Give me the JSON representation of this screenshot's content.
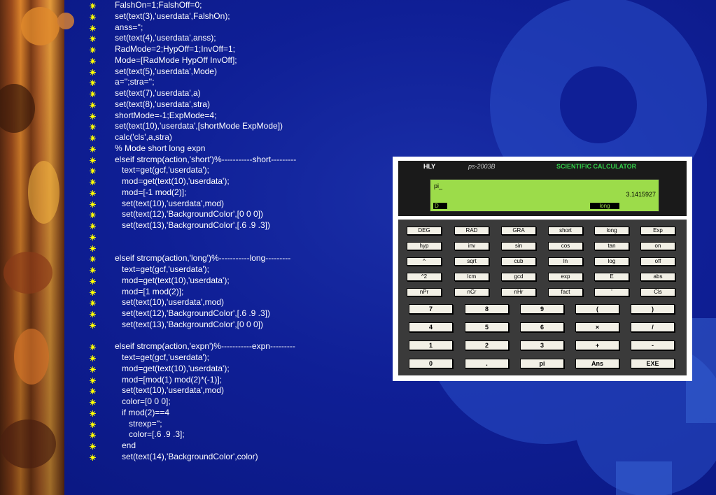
{
  "code_lines": [
    "FalshOn=1;FalshOff=0;",
    "set(text(3),'userdata',FalshOn);",
    "anss='';",
    "set(text(4),'userdata',anss);",
    "RadMode=2;HypOff=1;InvOff=1;",
    "Mode=[RadMode HypOff InvOff];",
    "set(text(5),'userdata',Mode)",
    "a='';stra='';",
    "set(text(7),'userdata',a)",
    "set(text(8),'userdata',stra)",
    "shortMode=-1;ExpMode=4;",
    "set(text(10),'userdata',[shortMode ExpMode])",
    "calc('cls',a,stra)",
    "% Mode short long expn",
    "elseif strcmp(action,'short')%-----------short---------",
    "   text=get(gcf,'userdata');",
    "   mod=get(text(10),'userdata');",
    "   mod=[-1 mod(2)];",
    "   set(text(10),'userdata',mod)",
    "   set(text(12),'BackgroundColor',[0 0 0])",
    "   set(text(13),'BackgroundColor',[.6 .9 .3])",
    "",
    "",
    "elseif strcmp(action,'long')%-----------long---------",
    "   text=get(gcf,'userdata');",
    "   mod=get(text(10),'userdata');",
    "   mod=[1 mod(2)];",
    "   set(text(10),'userdata',mod)",
    "   set(text(12),'BackgroundColor',[.6 .9 .3])",
    "   set(text(13),'BackgroundColor',[0 0 0])",
    null,
    "elseif strcmp(action,'expn')%-----------expn---------",
    "   text=get(gcf,'userdata');",
    "   mod=get(text(10),'userdata');",
    "   mod=[mod(1) mod(2)*(-1)];",
    "   set(text(10),'userdata',mod)",
    "   color=[0 0 0];",
    "   if mod(2)==4",
    "      strexp='';",
    "      color=[.6 .9 .3];",
    "   end",
    "   set(text(14),'BackgroundColor',color)"
  ],
  "calculator": {
    "brand": "HLY",
    "version": "ps-2003B",
    "title": "SCIENTIFIC CALCULATOR",
    "display_input": "pi_",
    "display_result": "3.1415927",
    "mode_indicator": "D",
    "format_indicator": "long",
    "function_rows": [
      [
        "DEG",
        "RAD",
        "GRA",
        "short",
        "long",
        "Exp"
      ],
      [
        "hyp",
        "inv",
        "sin",
        "cos",
        "tan",
        "on"
      ],
      [
        "^",
        "sqrt",
        "cub",
        "ln",
        "log",
        "off"
      ],
      [
        "^2",
        "lcm",
        "gcd",
        "exp",
        "E",
        "abs"
      ],
      [
        "nPr",
        "nCr",
        "nHr",
        "fact",
        "'",
        "Cls"
      ]
    ],
    "number_rows": [
      [
        "7",
        "8",
        "9",
        "(",
        ")"
      ],
      [
        "4",
        "5",
        "6",
        "×",
        "/"
      ],
      [
        "1",
        "2",
        "3",
        "+",
        "-"
      ],
      [
        "0",
        ".",
        "pi",
        "Ans",
        "EXE"
      ]
    ]
  },
  "colors": {
    "background": "#0c1a8c",
    "lcd": "#9cdc4a",
    "title_green": "#34d04a",
    "bullet": "#ffff00"
  }
}
